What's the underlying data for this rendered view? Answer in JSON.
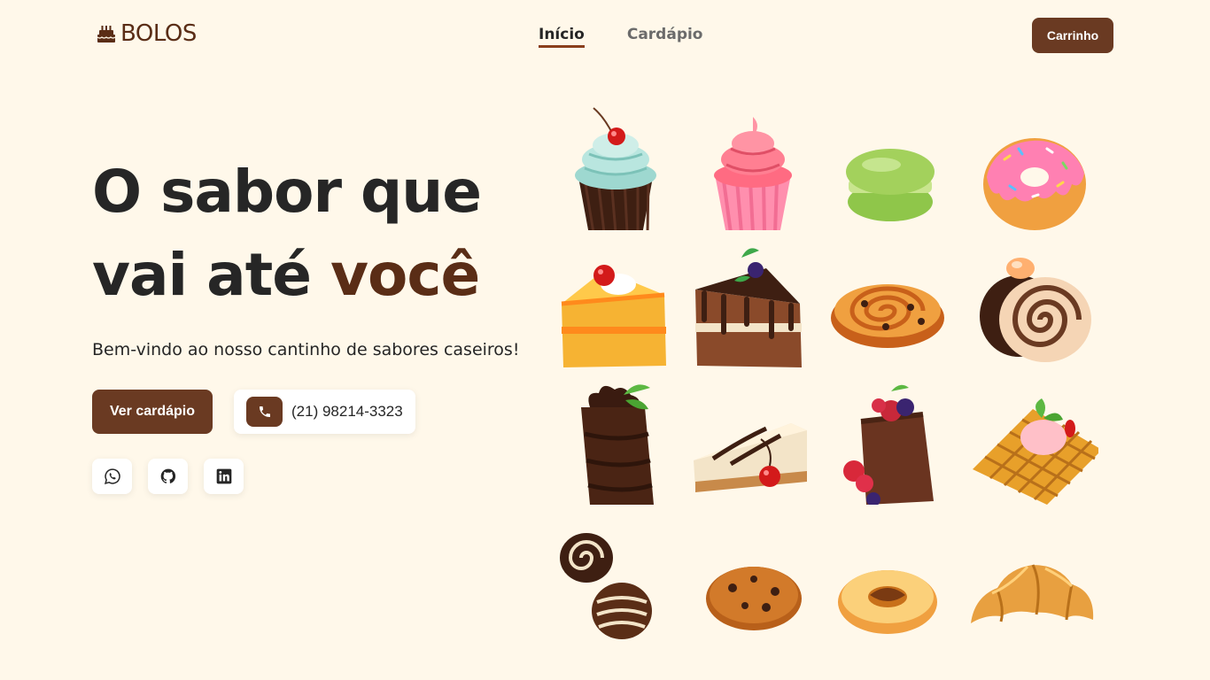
{
  "header": {
    "logo_text": "BOLOS",
    "nav": [
      {
        "label": "Início",
        "active": true
      },
      {
        "label": "Cardápio",
        "active": false
      }
    ],
    "cart_label": "Carrinho"
  },
  "hero": {
    "title_line1": "O sabor que",
    "title_line2_plain": "vai até ",
    "title_line2_accent": "você",
    "subtitle": "Bem-vindo ao nosso cantinho de sabores caseiros!",
    "menu_button": "Ver cardápio",
    "phone": "(21) 98214-3323"
  },
  "social": [
    {
      "name": "whatsapp-icon"
    },
    {
      "name": "github-icon"
    },
    {
      "name": "linkedin-icon"
    }
  ],
  "desserts": [
    "cupcake-cherry-icon",
    "cupcake-pink-icon",
    "macaron-icon",
    "donut-icon",
    "cake-slice-icon",
    "chocolate-cake-icon",
    "cinnamon-roll-icon",
    "swiss-roll-icon",
    "brownie-icon",
    "cheesecake-icon",
    "berry-cake-icon",
    "waffle-icon",
    "bonbon-icon",
    "cookie-icon",
    "almond-biscuit-icon",
    "croissant-icon"
  ],
  "colors": {
    "background": "#fff8ea",
    "accent": "#6a3a22",
    "accent_text": "#5a2d16",
    "text": "#262626"
  }
}
